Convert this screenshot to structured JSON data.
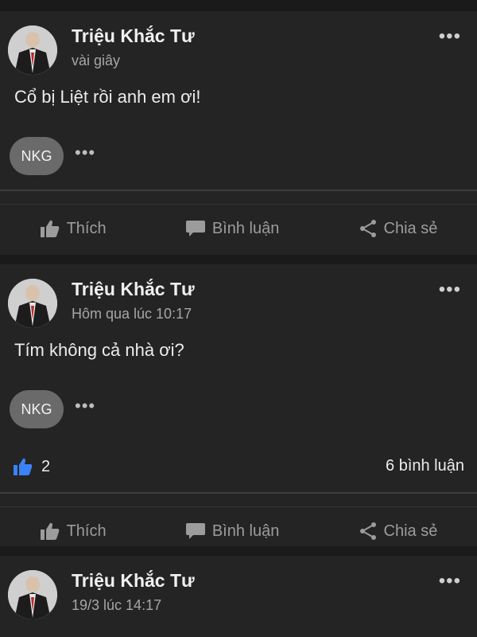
{
  "posts": [
    {
      "author": "Triệu Khắc Tư",
      "time": "vài giây",
      "content": "Cổ bị Liệt rồi anh em ơi!",
      "tag": "NKG",
      "tag_more": "•••",
      "menu": "•••",
      "likes": null,
      "comments": null,
      "actions": {
        "like": "Thích",
        "comment": "Bình luận",
        "share": "Chia sẻ"
      }
    },
    {
      "author": "Triệu Khắc Tư",
      "time": "Hôm qua lúc 10:17",
      "content": "Tím không cả nhà ơi?",
      "tag": "NKG",
      "tag_more": "•••",
      "menu": "•••",
      "likes": "2",
      "comments": "6 bình luận",
      "actions": {
        "like": "Thích",
        "comment": "Bình luận",
        "share": "Chia sẻ"
      }
    },
    {
      "author": "Triệu Khắc Tư",
      "time": "19/3 lúc 14:17",
      "menu": "•••"
    }
  ],
  "colors": {
    "background": "#1a1a1a",
    "card": "#242424",
    "like_accent": "#3b82f6",
    "chip": "#6a6a6a"
  },
  "icons": {
    "like": "thumbs-up-icon",
    "comment": "speech-bubble-icon",
    "share": "share-icon",
    "menu": "more-horizontal-icon"
  }
}
